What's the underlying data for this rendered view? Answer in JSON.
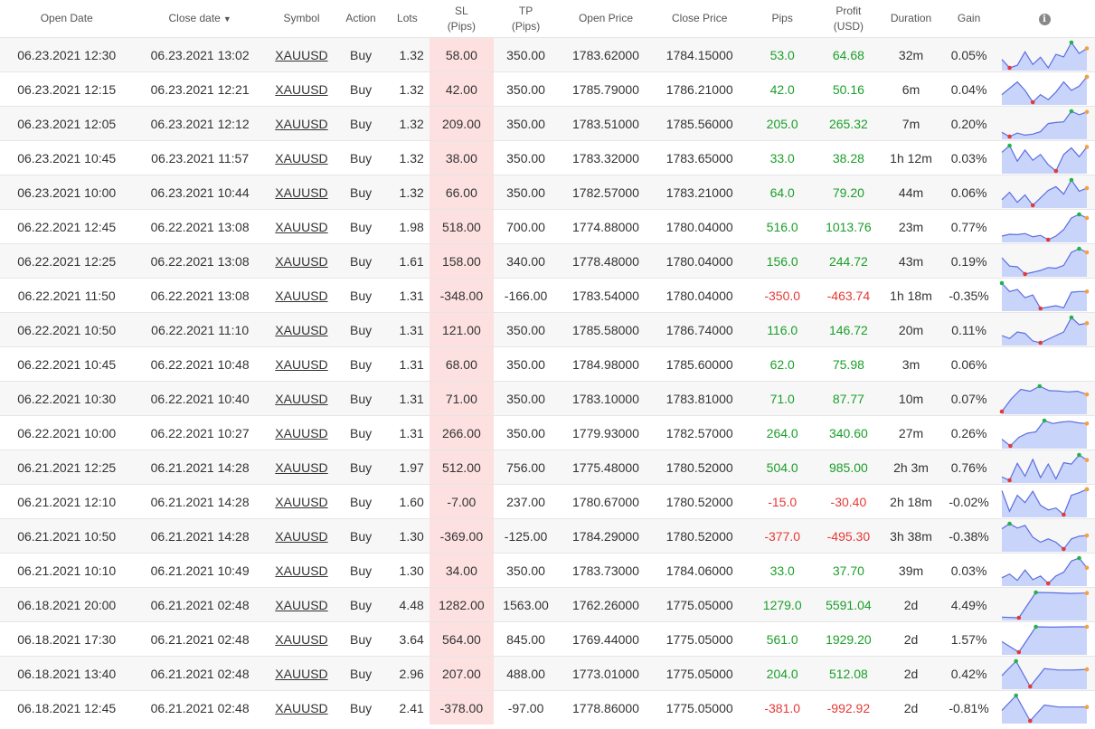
{
  "headers": {
    "open_date": "Open Date",
    "close_date": "Close date",
    "close_date_sort": "▼",
    "symbol": "Symbol",
    "action": "Action",
    "lots": "Lots",
    "sl_line1": "SL",
    "sl_line2": "(Pips)",
    "tp_line1": "TP",
    "tp_line2": "(Pips)",
    "open_price": "Open Price",
    "close_price": "Close Price",
    "pips": "Pips",
    "profit_line1": "Profit",
    "profit_line2": "(USD)",
    "duration": "Duration",
    "gain": "Gain",
    "info_icon": "i"
  },
  "colors": {
    "positive": "#1a9f29",
    "negative": "#e53935",
    "sl_highlight": "#fde0e0",
    "spark_line": "#5b6ee1",
    "spark_fill": "#c9d4fb",
    "spark_max": "#22b24c",
    "spark_min": "#e53935",
    "spark_end": "#f4a142"
  },
  "trades": [
    {
      "open_date": "06.23.2021 12:30",
      "close_date": "06.23.2021 13:02",
      "symbol": "XAUUSD",
      "action": "Buy",
      "lots": "1.32",
      "sl": "58.00",
      "tp": "350.00",
      "open_price": "1783.62000",
      "close_price": "1784.15000",
      "pips": "53.0",
      "profit": "64.68",
      "duration": "32m",
      "gain": "0.05%",
      "sign": "pos",
      "spark": [
        30,
        10,
        16,
        48,
        18,
        35,
        10,
        42,
        36,
        70,
        44,
        56
      ]
    },
    {
      "open_date": "06.23.2021 12:15",
      "close_date": "06.23.2021 12:21",
      "symbol": "XAUUSD",
      "action": "Buy",
      "lots": "1.32",
      "sl": "42.00",
      "tp": "350.00",
      "open_price": "1785.79000",
      "close_price": "1786.21000",
      "pips": "42.0",
      "profit": "50.16",
      "duration": "6m",
      "gain": "0.04%",
      "sign": "pos",
      "spark": [
        30,
        45,
        60,
        40,
        12,
        30,
        18,
        36,
        60,
        40,
        50,
        72
      ]
    },
    {
      "open_date": "06.23.2021 12:05",
      "close_date": "06.23.2021 12:12",
      "symbol": "XAUUSD",
      "action": "Buy",
      "lots": "1.32",
      "sl": "209.00",
      "tp": "350.00",
      "open_price": "1783.51000",
      "close_price": "1785.56000",
      "pips": "205.0",
      "profit": "265.32",
      "duration": "7m",
      "gain": "0.20%",
      "sign": "pos",
      "spark": [
        20,
        8,
        18,
        12,
        15,
        22,
        45,
        48,
        50,
        80,
        70,
        78
      ]
    },
    {
      "open_date": "06.23.2021 10:45",
      "close_date": "06.23.2021 11:57",
      "symbol": "XAUUSD",
      "action": "Buy",
      "lots": "1.32",
      "sl": "38.00",
      "tp": "350.00",
      "open_price": "1783.32000",
      "close_price": "1783.65000",
      "pips": "33.0",
      "profit": "38.28",
      "duration": "1h 12m",
      "gain": "0.03%",
      "sign": "pos",
      "spark": [
        50,
        65,
        30,
        55,
        32,
        45,
        22,
        8,
        45,
        60,
        40,
        62
      ]
    },
    {
      "open_date": "06.23.2021 10:00",
      "close_date": "06.23.2021 10:44",
      "symbol": "XAUUSD",
      "action": "Buy",
      "lots": "1.32",
      "sl": "66.00",
      "tp": "350.00",
      "open_price": "1782.57000",
      "close_price": "1783.21000",
      "pips": "64.0",
      "profit": "79.20",
      "duration": "44m",
      "gain": "0.06%",
      "sign": "pos",
      "spark": [
        25,
        45,
        18,
        38,
        10,
        30,
        50,
        60,
        40,
        78,
        48,
        56
      ]
    },
    {
      "open_date": "06.22.2021 12:45",
      "close_date": "06.22.2021 13:08",
      "symbol": "XAUUSD",
      "action": "Buy",
      "lots": "1.98",
      "sl": "518.00",
      "tp": "700.00",
      "open_price": "1774.88000",
      "close_price": "1780.04000",
      "pips": "516.0",
      "profit": "1013.76",
      "duration": "23m",
      "gain": "0.77%",
      "sign": "pos",
      "spark": [
        20,
        25,
        24,
        27,
        18,
        22,
        10,
        20,
        38,
        70,
        80,
        70
      ]
    },
    {
      "open_date": "06.22.2021 12:25",
      "close_date": "06.22.2021 13:08",
      "symbol": "XAUUSD",
      "action": "Buy",
      "lots": "1.61",
      "sl": "158.00",
      "tp": "340.00",
      "open_price": "1778.48000",
      "close_price": "1780.04000",
      "pips": "156.0",
      "profit": "244.72",
      "duration": "43m",
      "gain": "0.19%",
      "sign": "pos",
      "spark": [
        55,
        32,
        30,
        10,
        15,
        20,
        28,
        26,
        34,
        70,
        80,
        70
      ]
    },
    {
      "open_date": "06.22.2021 11:50",
      "close_date": "06.22.2021 13:08",
      "symbol": "XAUUSD",
      "action": "Buy",
      "lots": "1.31",
      "sl": "-348.00",
      "tp": "-166.00",
      "open_price": "1783.54000",
      "close_price": "1780.04000",
      "pips": "-350.0",
      "profit": "-463.74",
      "duration": "1h 18m",
      "gain": "-0.35%",
      "sign": "neg",
      "spark": [
        85,
        60,
        66,
        42,
        50,
        10,
        14,
        18,
        12,
        58,
        60,
        60
      ]
    },
    {
      "open_date": "06.22.2021 10:50",
      "close_date": "06.22.2021 11:10",
      "symbol": "XAUUSD",
      "action": "Buy",
      "lots": "1.31",
      "sl": "121.00",
      "tp": "350.00",
      "open_price": "1785.58000",
      "close_price": "1786.74000",
      "pips": "116.0",
      "profit": "146.72",
      "duration": "20m",
      "gain": "0.11%",
      "sign": "pos",
      "spark": [
        30,
        22,
        40,
        36,
        15,
        10,
        20,
        30,
        40,
        80,
        60,
        64
      ]
    },
    {
      "open_date": "06.22.2021 10:45",
      "close_date": "06.22.2021 10:48",
      "symbol": "XAUUSD",
      "action": "Buy",
      "lots": "1.31",
      "sl": "68.00",
      "tp": "350.00",
      "open_price": "1784.98000",
      "close_price": "1785.60000",
      "pips": "62.0",
      "profit": "75.98",
      "duration": "3m",
      "gain": "0.06%",
      "sign": "pos",
      "spark": []
    },
    {
      "open_date": "06.22.2021 10:30",
      "close_date": "06.22.2021 10:40",
      "symbol": "XAUUSD",
      "action": "Buy",
      "lots": "1.31",
      "sl": "71.00",
      "tp": "350.00",
      "open_price": "1783.10000",
      "close_price": "1783.81000",
      "pips": "71.0",
      "profit": "87.77",
      "duration": "10m",
      "gain": "0.07%",
      "sign": "pos",
      "spark": [
        10,
        50,
        80,
        74,
        90,
        76,
        75,
        72,
        74,
        64
      ]
    },
    {
      "open_date": "06.22.2021 10:00",
      "close_date": "06.22.2021 10:27",
      "symbol": "XAUUSD",
      "action": "Buy",
      "lots": "1.31",
      "sl": "266.00",
      "tp": "350.00",
      "open_price": "1779.93000",
      "close_price": "1782.57000",
      "pips": "264.0",
      "profit": "340.60",
      "duration": "27m",
      "gain": "0.26%",
      "sign": "pos",
      "spark": [
        30,
        12,
        35,
        46,
        50,
        80,
        72,
        76,
        78,
        74,
        72
      ]
    },
    {
      "open_date": "06.21.2021 12:25",
      "close_date": "06.21.2021 14:28",
      "symbol": "XAUUSD",
      "action": "Buy",
      "lots": "1.97",
      "sl": "512.00",
      "tp": "756.00",
      "open_price": "1775.48000",
      "close_price": "1780.52000",
      "pips": "504.0",
      "profit": "985.00",
      "duration": "2h 3m",
      "gain": "0.76%",
      "sign": "pos",
      "spark": [
        20,
        10,
        60,
        22,
        72,
        18,
        58,
        14,
        62,
        58,
        85,
        70
      ]
    },
    {
      "open_date": "06.21.2021 12:10",
      "close_date": "06.21.2021 14:28",
      "symbol": "XAUUSD",
      "action": "Buy",
      "lots": "1.60",
      "sl": "-7.00",
      "tp": "237.00",
      "open_price": "1780.67000",
      "close_price": "1780.52000",
      "pips": "-15.0",
      "profit": "-30.40",
      "duration": "2h 18m",
      "gain": "-0.02%",
      "sign": "neg",
      "spark": [
        84,
        22,
        70,
        48,
        82,
        40,
        26,
        32,
        12,
        70,
        78,
        88
      ]
    },
    {
      "open_date": "06.21.2021 10:50",
      "close_date": "06.21.2021 14:28",
      "symbol": "XAUUSD",
      "action": "Buy",
      "lots": "1.30",
      "sl": "-369.00",
      "tp": "-125.00",
      "open_price": "1784.29000",
      "close_price": "1780.52000",
      "pips": "-377.0",
      "profit": "-495.30",
      "duration": "3h 38m",
      "gain": "-0.38%",
      "sign": "neg",
      "spark": [
        70,
        85,
        72,
        80,
        45,
        30,
        40,
        30,
        10,
        40,
        48,
        50
      ]
    },
    {
      "open_date": "06.21.2021 10:10",
      "close_date": "06.21.2021 10:49",
      "symbol": "XAUUSD",
      "action": "Buy",
      "lots": "1.30",
      "sl": "34.00",
      "tp": "350.00",
      "open_price": "1783.73000",
      "close_price": "1784.06000",
      "pips": "33.0",
      "profit": "37.70",
      "duration": "39m",
      "gain": "0.03%",
      "sign": "pos",
      "spark": [
        25,
        35,
        18,
        46,
        20,
        30,
        10,
        30,
        40,
        70,
        78,
        52
      ]
    },
    {
      "open_date": "06.18.2021 20:00",
      "close_date": "06.21.2021 02:48",
      "symbol": "XAUUSD",
      "action": "Buy",
      "lots": "4.48",
      "sl": "1282.00",
      "tp": "1563.00",
      "open_price": "1762.26000",
      "close_price": "1775.05000",
      "pips": "1279.0",
      "profit": "5591.04",
      "duration": "2d",
      "gain": "4.49%",
      "sign": "pos",
      "spark": [
        10,
        8,
        85,
        84,
        82,
        83
      ]
    },
    {
      "open_date": "06.18.2021 17:30",
      "close_date": "06.21.2021 02:48",
      "symbol": "XAUUSD",
      "action": "Buy",
      "lots": "3.64",
      "sl": "564.00",
      "tp": "845.00",
      "open_price": "1769.44000",
      "close_price": "1775.05000",
      "pips": "561.0",
      "profit": "1929.20",
      "duration": "2d",
      "gain": "1.57%",
      "sign": "pos",
      "spark": [
        40,
        8,
        85,
        84,
        85,
        85
      ]
    },
    {
      "open_date": "06.18.2021 13:40",
      "close_date": "06.21.2021 02:48",
      "symbol": "XAUUSD",
      "action": "Buy",
      "lots": "2.96",
      "sl": "207.00",
      "tp": "488.00",
      "open_price": "1773.01000",
      "close_price": "1775.05000",
      "pips": "204.0",
      "profit": "512.08",
      "duration": "2d",
      "gain": "0.42%",
      "sign": "pos",
      "spark": [
        40,
        82,
        8,
        60,
        56,
        56,
        58
      ]
    },
    {
      "open_date": "06.18.2021 12:45",
      "close_date": "06.21.2021 02:48",
      "symbol": "XAUUSD",
      "action": "Buy",
      "lots": "2.41",
      "sl": "-378.00",
      "tp": "-97.00",
      "open_price": "1778.86000",
      "close_price": "1775.05000",
      "pips": "-381.0",
      "profit": "-992.92",
      "duration": "2d",
      "gain": "-0.81%",
      "sign": "neg",
      "spark": [
        40,
        85,
        8,
        56,
        50,
        50,
        50
      ]
    }
  ]
}
